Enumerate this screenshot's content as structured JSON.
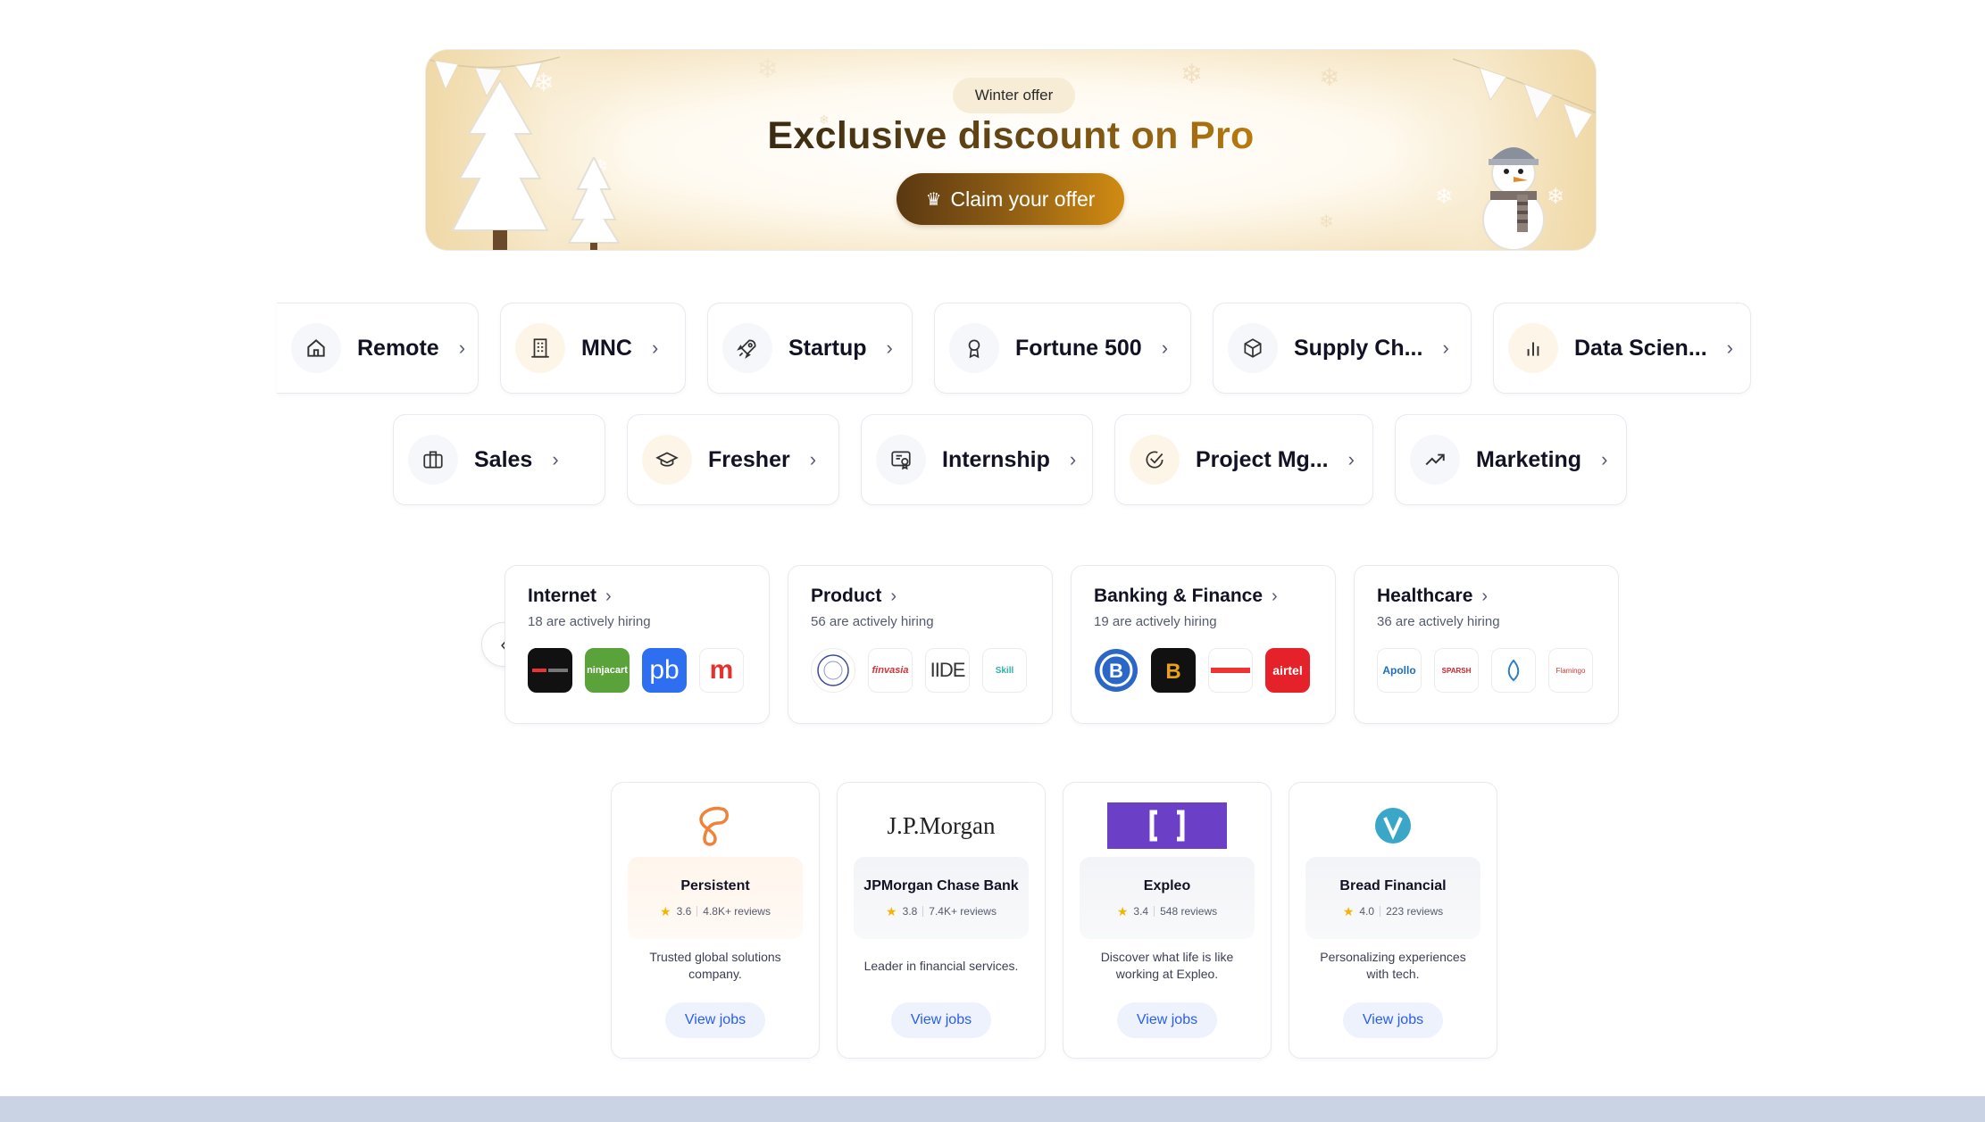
{
  "banner": {
    "badge": "Winter offer",
    "title": "Exclusive discount on Pro",
    "cta": "Claim your offer",
    "cta_icon": "crown-icon"
  },
  "categories_row1": [
    {
      "label": "Remote",
      "icon": "home-icon"
    },
    {
      "label": "MNC",
      "icon": "building-icon"
    },
    {
      "label": "Startup",
      "icon": "rocket-icon"
    },
    {
      "label": "Fortune 500",
      "icon": "award-icon"
    },
    {
      "label": "Supply Ch...",
      "icon": "box-icon"
    },
    {
      "label": "Data Scien...",
      "icon": "bar-chart-icon"
    }
  ],
  "categories_row2": [
    {
      "label": "Sales",
      "icon": "briefcase-icon"
    },
    {
      "label": "Fresher",
      "icon": "graduation-cap-icon"
    },
    {
      "label": "Internship",
      "icon": "certificate-icon"
    },
    {
      "label": "Project Mg...",
      "icon": "check-circle-icon"
    },
    {
      "label": "Marketing",
      "icon": "trending-up-icon"
    }
  ],
  "industries": [
    {
      "title": "Internet",
      "subtitle": "18 are actively hiring",
      "logos": [
        "",
        "ninjacart",
        "pb",
        "m"
      ]
    },
    {
      "title": "Product",
      "subtitle": "56 are actively hiring",
      "logos": [
        "",
        "finvasia",
        "IIDE",
        "Skill"
      ]
    },
    {
      "title": "Banking & Finance",
      "subtitle": "19 are actively hiring",
      "logos": [
        "",
        "",
        "",
        "airtel"
      ]
    },
    {
      "title": "Healthcare",
      "subtitle": "36 are actively hiring",
      "logos": [
        "Apollo",
        "SPARSH",
        "",
        "Flamingo"
      ]
    }
  ],
  "companies": [
    {
      "name": "Persistent",
      "rating": "3.6",
      "reviews": "4.8K+ reviews",
      "desc": "Trusted global solutions company.",
      "cta": "View jobs"
    },
    {
      "name": "JPMorgan Chase Bank",
      "logo_text": "J.P.Morgan",
      "rating": "3.8",
      "reviews": "7.4K+ reviews",
      "desc": "Leader in financial services.",
      "cta": "View jobs"
    },
    {
      "name": "Expleo",
      "rating": "3.4",
      "reviews": "548 reviews",
      "desc": "Discover what life is like working at Expleo.",
      "cta": "View jobs"
    },
    {
      "name": "Bread Financial",
      "rating": "4.0",
      "reviews": "223 reviews",
      "desc": "Personalizing experiences with tech.",
      "cta": "View jobs"
    }
  ],
  "colors": {
    "accent_blue": "#275df5",
    "banner_gold": "#d08b12",
    "banner_brown": "#5a3812",
    "expleo_purple": "#6c3fc7",
    "star": "#f5b400"
  }
}
